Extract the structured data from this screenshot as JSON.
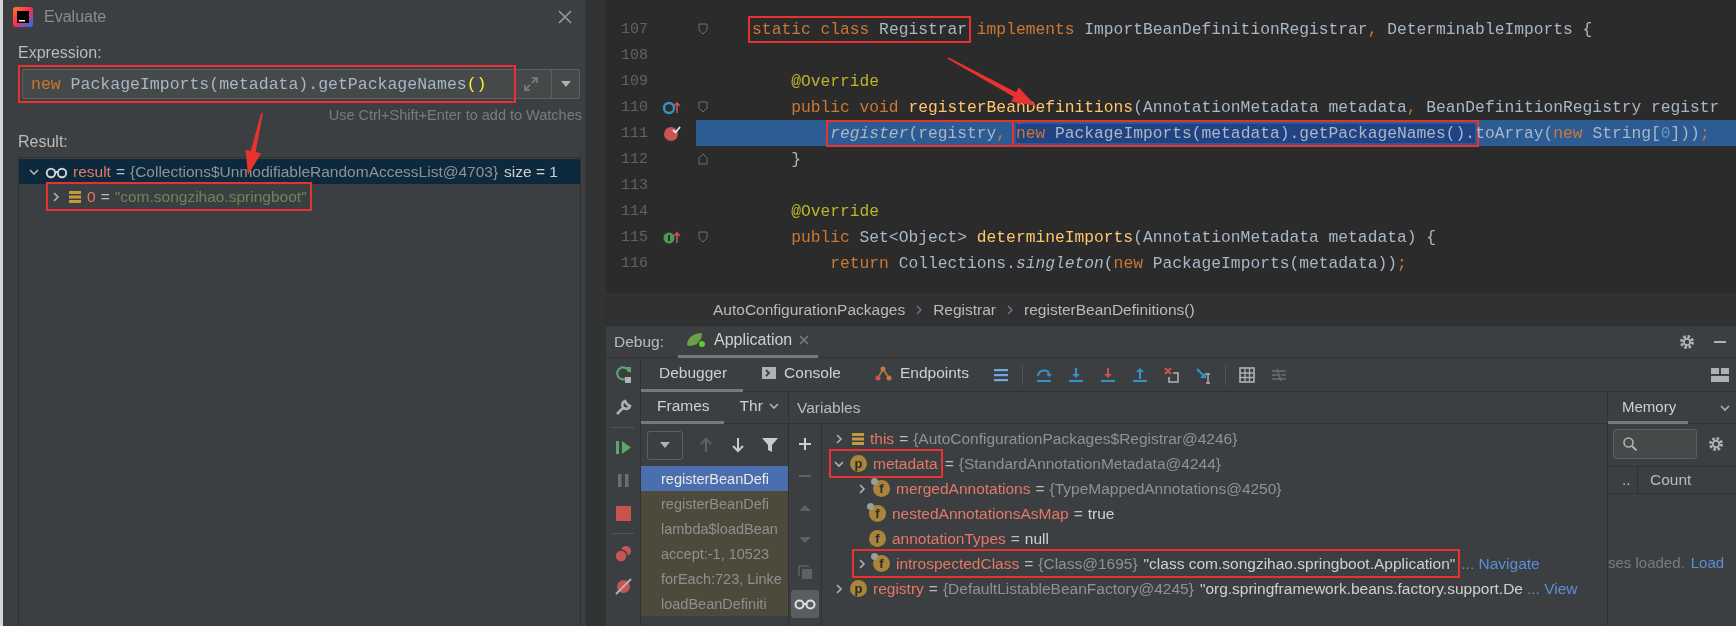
{
  "evaluate": {
    "title": "Evaluate",
    "expression_label": "Expression:",
    "expression": {
      "boxed": true,
      "tokens": [
        {
          "kind": "keyword",
          "text": "new"
        },
        {
          "kind": "plain",
          "text": " PackageImports(metadata).getPackageNames"
        },
        {
          "kind": "brace",
          "text": "()"
        }
      ]
    },
    "hint": "Use Ctrl+Shift+Enter to add to Watches",
    "result_label": "Result:",
    "result": [
      {
        "name": "result",
        "op": "=",
        "value": "{Collections$UnmodifiableRandomAccessList@4703}",
        "kind": "object",
        "extra": "size = 1",
        "expanded": true,
        "selected": true,
        "boxed": false,
        "children": [
          {
            "name": "0",
            "op": "=",
            "value": "\"com.songzihao.springboot\"",
            "kind": "string",
            "expanded": false,
            "selected": false,
            "boxed": true
          }
        ]
      }
    ]
  },
  "editor": {
    "lines": [
      {
        "number": "107",
        "kind": "plain",
        "current": false,
        "breakpoint": false,
        "fold_start": true,
        "fold_end": false,
        "tokens": [
          {
            "kind": "boxed",
            "selected": false,
            "tokens": [
              {
                "kind": "keyword",
                "text": "    static class "
              },
              {
                "kind": "plain",
                "text": "Registrar"
              }
            ]
          },
          {
            "kind": "keyword",
            "text": " implements "
          },
          {
            "kind": "plain",
            "text": "ImportBeanDefinitionRegistrar"
          },
          {
            "kind": "keyword",
            "text": ", "
          },
          {
            "kind": "plain",
            "text": "DeterminableImports {"
          }
        ]
      },
      {
        "number": "108",
        "kind": "plain",
        "current": false,
        "breakpoint": false,
        "fold_start": false,
        "fold_end": false
      },
      {
        "number": "109",
        "kind": "plain",
        "current": false,
        "breakpoint": false,
        "fold_start": false,
        "fold_end": false,
        "tokens": [
          {
            "kind": "annotation",
            "text": "        @Override"
          }
        ]
      },
      {
        "number": "110",
        "kind": "override",
        "current": false,
        "breakpoint": false,
        "fold_start": true,
        "fold_end": false,
        "tokens": [
          {
            "kind": "keyword",
            "text": "        public void "
          },
          {
            "kind": "method",
            "text": "registerBeanDefinitions"
          },
          {
            "kind": "plain",
            "text": "(AnnotationMetadata metadata"
          },
          {
            "kind": "keyword",
            "text": ", "
          },
          {
            "kind": "plain",
            "text": "BeanDefinitionRegistry registr"
          }
        ]
      },
      {
        "number": "111",
        "kind": "plain",
        "current": true,
        "breakpoint": true,
        "fold_start": false,
        "fold_end": false,
        "tokens": [
          {
            "kind": "boxed",
            "selected": false,
            "tokens": [
              {
                "kind": "italic",
                "text": "            register"
              },
              {
                "kind": "plain",
                "text": "(registry"
              },
              {
                "kind": "keyword",
                "text": ", "
              }
            ]
          },
          {
            "kind": "boxed",
            "selected": true,
            "tokens": [
              {
                "kind": "keyword",
                "text": "new "
              },
              {
                "kind": "plain",
                "text": "PackageImports(metadata).getPackageNames()."
              }
            ]
          },
          {
            "kind": "plain",
            "text": "toArray("
          },
          {
            "kind": "keyword",
            "text": "new "
          },
          {
            "kind": "plain",
            "text": "String["
          },
          {
            "kind": "number",
            "text": "0"
          },
          {
            "kind": "plain",
            "text": "]))"
          },
          {
            "kind": "keyword",
            "text": ";"
          }
        ]
      },
      {
        "number": "112",
        "kind": "plain",
        "current": false,
        "breakpoint": false,
        "fold_start": false,
        "fold_end": true,
        "tokens": [
          {
            "kind": "plain",
            "text": "        }"
          }
        ]
      },
      {
        "number": "113",
        "kind": "plain",
        "current": false,
        "breakpoint": false,
        "fold_start": false,
        "fold_end": false
      },
      {
        "number": "114",
        "kind": "plain",
        "current": false,
        "breakpoint": false,
        "fold_start": false,
        "fold_end": false,
        "tokens": [
          {
            "kind": "annotation",
            "text": "        @Override"
          }
        ]
      },
      {
        "number": "115",
        "kind": "implement",
        "current": false,
        "breakpoint": false,
        "fold_start": true,
        "fold_end": false,
        "tokens": [
          {
            "kind": "keyword",
            "text": "        public "
          },
          {
            "kind": "plain",
            "text": "Set<Object> "
          },
          {
            "kind": "method",
            "text": "determineImports"
          },
          {
            "kind": "plain",
            "text": "(AnnotationMetadata metadata) {"
          }
        ]
      },
      {
        "number": "116",
        "kind": "plain",
        "current": false,
        "breakpoint": false,
        "fold_start": false,
        "fold_end": false,
        "tokens": [
          {
            "kind": "keyword",
            "text": "            return "
          },
          {
            "kind": "plain",
            "text": "Collections."
          },
          {
            "kind": "italic",
            "text": "singleton"
          },
          {
            "kind": "plain",
            "text": "("
          },
          {
            "kind": "keyword",
            "text": "new "
          },
          {
            "kind": "plain",
            "text": "PackageImports(metadata))"
          },
          {
            "kind": "keyword",
            "text": ";"
          }
        ]
      }
    ],
    "breadcrumbs": [
      "AutoConfigurationPackages",
      "Registrar",
      "registerBeanDefinitions()"
    ]
  },
  "debug": {
    "label": "Debug:",
    "sessions": [
      {
        "title": "Application",
        "selected": true
      }
    ],
    "tabs": [
      {
        "label": "Debugger",
        "selected": true
      },
      {
        "label": "Console",
        "selected": false
      },
      {
        "label": "Endpoints",
        "selected": false
      }
    ],
    "frames_tabs": [
      {
        "label": "Frames",
        "selected": true
      },
      {
        "label": "Thr",
        "selected": false
      }
    ],
    "frames": [
      {
        "text": "registerBeanDefi",
        "selected": true
      },
      {
        "text": "registerBeanDefi",
        "selected": false
      },
      {
        "text": "lambda$loadBean",
        "selected": false
      },
      {
        "text": "accept:-1, 10523",
        "selected": false
      },
      {
        "text": "forEach:723, Linke",
        "selected": false
      },
      {
        "text": "loadBeanDefiniti",
        "selected": false
      }
    ],
    "variables_title": "Variables",
    "variables": [
      {
        "name": "this",
        "op": "=",
        "value": "{AutoConfigurationPackages$Registrar@4246}",
        "kind": "object",
        "expanded": false,
        "boxed": false
      },
      {
        "name": "metadata",
        "badge": "p",
        "op": "=",
        "value": "{StandardAnnotationMetadata@4244}",
        "kind": "object",
        "expanded": true,
        "boxed": true,
        "children": [
          {
            "name": "mergedAnnotations",
            "badge": "f",
            "final": true,
            "op": "=",
            "value": "{TypeMappedAnnotations@4250}",
            "kind": "object",
            "expanded": false,
            "boxed": false
          },
          {
            "name": "nestedAnnotationsAsMap",
            "badge": "f",
            "final": true,
            "op": "=",
            "value": "true",
            "kind": "literal",
            "boxed": false
          },
          {
            "name": "annotationTypes",
            "badge": "f",
            "final": false,
            "op": "=",
            "value": "null",
            "kind": "literal",
            "boxed": false
          },
          {
            "name": "introspectedClass",
            "badge": "f",
            "final": true,
            "op": "=",
            "value": "{Class@1695}",
            "kind": "object",
            "extra": "\"class com.songzihao.springboot.Application\"",
            "link": "... Navigate",
            "expanded": false,
            "boxed": true
          }
        ]
      },
      {
        "name": "registry",
        "badge": "p",
        "op": "=",
        "value": "{DefaultListableBeanFactory@4245}",
        "kind": "object",
        "extra": "\"org.springframework.beans.factory.support.De",
        "link": "... View",
        "expanded": false,
        "boxed": false
      }
    ],
    "memory": {
      "tab": "Memory",
      "column_1": "..",
      "column_2": "Count",
      "status": "ses loaded.",
      "link": "Load"
    }
  }
}
